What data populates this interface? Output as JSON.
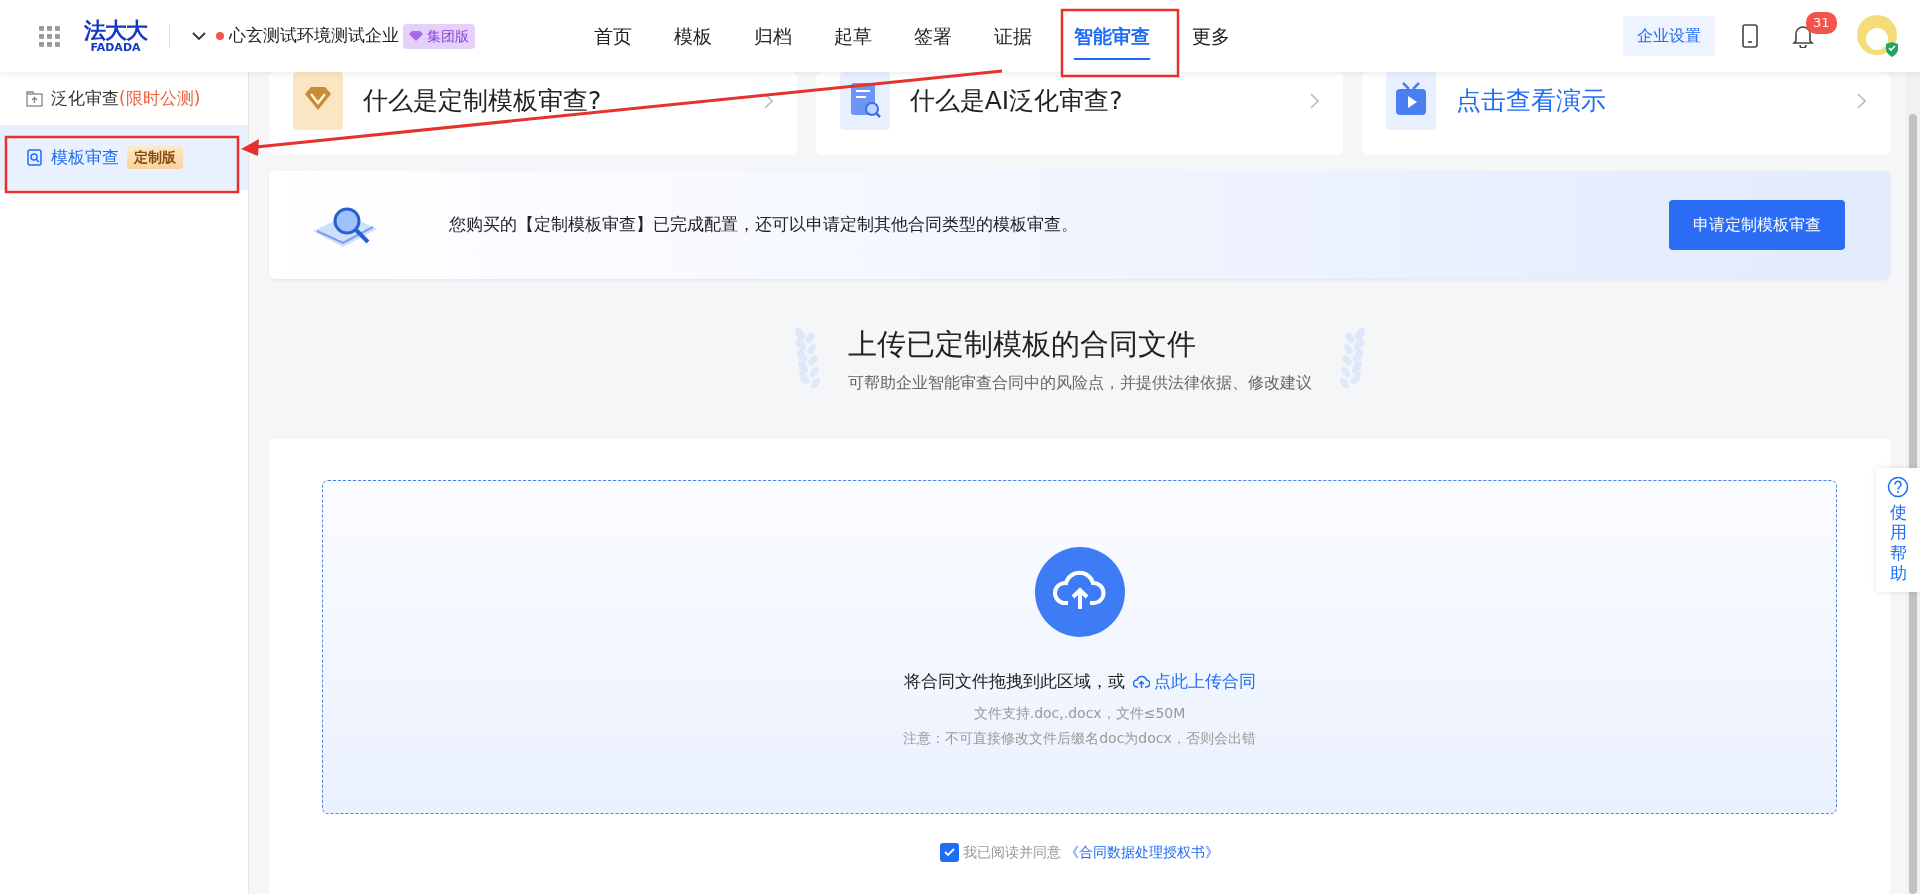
{
  "header": {
    "logo": {
      "mark": "法大大",
      "wordmark": "FADADA"
    },
    "company": "心玄测试环境测试企业",
    "edition_badge": "集团版",
    "nav": [
      {
        "label": "首页",
        "selected": false
      },
      {
        "label": "模板",
        "selected": false
      },
      {
        "label": "归档",
        "selected": false
      },
      {
        "label": "起草",
        "selected": false
      },
      {
        "label": "签署",
        "selected": false
      },
      {
        "label": "证据",
        "selected": false
      },
      {
        "label": "智能审查",
        "selected": true
      },
      {
        "label": "更多",
        "selected": false
      }
    ],
    "settings_button": "企业设置",
    "notification_count": "31"
  },
  "sidebar": {
    "items": [
      {
        "label": "泛化审查",
        "note": "(限时公测)",
        "selected": false
      },
      {
        "label": "模板审查",
        "tag": "定制版",
        "selected": true
      }
    ]
  },
  "intro_cards": [
    {
      "kind": "gem",
      "title": "什么是定制模板审查?"
    },
    {
      "kind": "document",
      "title": "什么是AI泛化审查?"
    },
    {
      "kind": "video",
      "title": "点击查看演示"
    }
  ],
  "banner": {
    "text": "您购买的【定制模板审查】已完成配置，还可以申请定制其他合同类型的模板审查。",
    "button": "申请定制模板审查"
  },
  "upload": {
    "title": "上传已定制模板的合同文件",
    "subtitle": "可帮助企业智能审查合同中的风险点，并提供法律依据、修改建议",
    "drop_text": "将合同文件拖拽到此区域，或",
    "upload_link": "点此上传合同",
    "formats": "文件支持.doc,.docx，文件≤50M",
    "note": "注意：不可直接修改文件后缀名doc为docx，否则会出错",
    "agreement": {
      "checked": true,
      "text": "我已阅读并同意",
      "link": "《合同数据处理授权书》"
    }
  },
  "help": {
    "label": "使用帮助"
  }
}
